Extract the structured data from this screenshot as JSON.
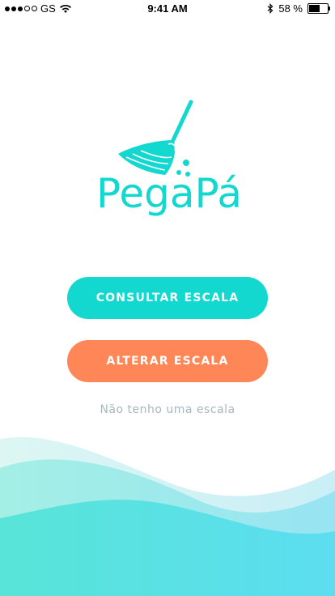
{
  "status_bar": {
    "carrier": "GS",
    "time": "9:41 AM",
    "battery": "58 %",
    "battery_level": 0.58,
    "signal_bars": 3,
    "icons": [
      "signal-dots",
      "wifi-icon",
      "bluetooth-icon",
      "battery-icon"
    ]
  },
  "logo": {
    "text": "PegaPá",
    "icon": "broom-icon",
    "color": "#12D8D0"
  },
  "buttons": {
    "consultar": "CONSULTAR ESCALA",
    "alterar": "ALTERAR ESCALA"
  },
  "link": {
    "no_scale": "Não tenho uma escala"
  },
  "colors": {
    "primary": "#12D8D0",
    "secondary": "#FF8657",
    "muted_text": "#A6B8BC",
    "background": "#FFFFFF"
  }
}
